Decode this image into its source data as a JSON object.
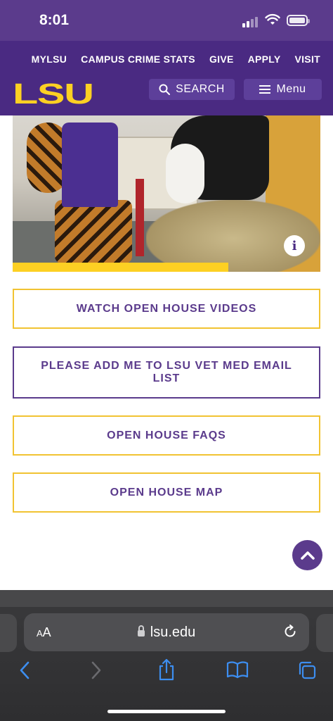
{
  "status_bar": {
    "time": "8:01"
  },
  "header": {
    "nav_links": [
      "MYLSU",
      "CAMPUS CRIME STATS",
      "GIVE",
      "APPLY",
      "VISIT"
    ],
    "logo": "LSU",
    "search_label": "SEARCH",
    "menu_label": "Menu",
    "brand_colors": {
      "purple": "#4a2a82",
      "gold": "#fdd023"
    }
  },
  "hero": {
    "carousel_progress_fraction": 0.7,
    "info_icon": "i"
  },
  "buttons": [
    "WATCH OPEN HOUSE VIDEOS",
    "PLEASE ADD ME TO LSU VET MED EMAIL LIST",
    "OPEN HOUSE FAQS",
    "OPEN HOUSE MAP"
  ],
  "browser": {
    "aa_label_small": "A",
    "aa_label_large": "A",
    "url": "lsu.edu"
  },
  "icons": [
    "search-icon",
    "menu-icon",
    "info-icon",
    "chevron-up-icon",
    "lock-icon",
    "reload-icon",
    "back-icon",
    "forward-icon",
    "share-icon",
    "bookmarks-icon",
    "tabs-icon"
  ]
}
